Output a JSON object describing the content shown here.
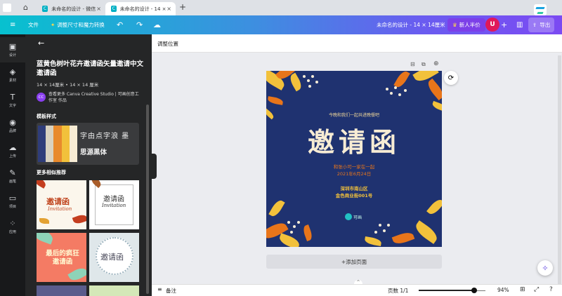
{
  "tabs": [
    {
      "label": "未命名的设计 - 微信..."
    },
    {
      "label": "未命名的设计 - 14 × 1..."
    }
  ],
  "toolbar": {
    "file": "文件",
    "resize": "调整尺寸和魔力转换",
    "doc_title": "未命名的设计 - 14 × 14厘米",
    "promo": "新人半价",
    "avatar": "U",
    "export": "导出"
  },
  "sidebar": {
    "items": [
      {
        "label": "设计"
      },
      {
        "label": "素材"
      },
      {
        "label": "文字"
      },
      {
        "label": "品牌"
      },
      {
        "label": "上传"
      },
      {
        "label": "画笔"
      },
      {
        "label": "项目"
      },
      {
        "label": "应用"
      }
    ]
  },
  "panel": {
    "title": "蓝黄色树叶花卉邀请函矢量邀请中文邀请函",
    "size": "14 × 14厘米 • 14 × 14 厘米",
    "author_badge": "CC",
    "author_text": "查看更多 Canva Creative Studio | 可画创意工作室 作品",
    "styles_heading": "模板样式",
    "style_font_line1": "字由点字浪 墨",
    "style_font_line2": "思源黑体",
    "more_heading": "更多相似推荐",
    "thumbs": [
      {
        "text": "邀请函",
        "sub": "Invitation"
      },
      {
        "text": "邀请函",
        "sub": "Invitation"
      },
      {
        "text": "最后的疯狂 邀请函",
        "sub": ""
      },
      {
        "text": "邀请函",
        "sub": ""
      }
    ]
  },
  "canvas": {
    "position_label": "调整位置",
    "add_page": "+添加页面"
  },
  "design": {
    "top_text": "今晚和我们一起共进晚餐吧",
    "main_title": "邀请函",
    "sub1": "和张小可一家在一起",
    "sub2": "2021年6月24日",
    "loc1": "深圳市南山区",
    "loc2": "金色商业街001号",
    "logo_text": "可画"
  },
  "bottombar": {
    "notes": "备注",
    "pages": "页数 1/1",
    "zoom": "94%",
    "zoom_level": 0.83
  },
  "colors": {
    "bg_navy": "#1f3270",
    "gold": "#f2c13b",
    "orange": "#e8751a",
    "promo": "#7b3ff2"
  }
}
